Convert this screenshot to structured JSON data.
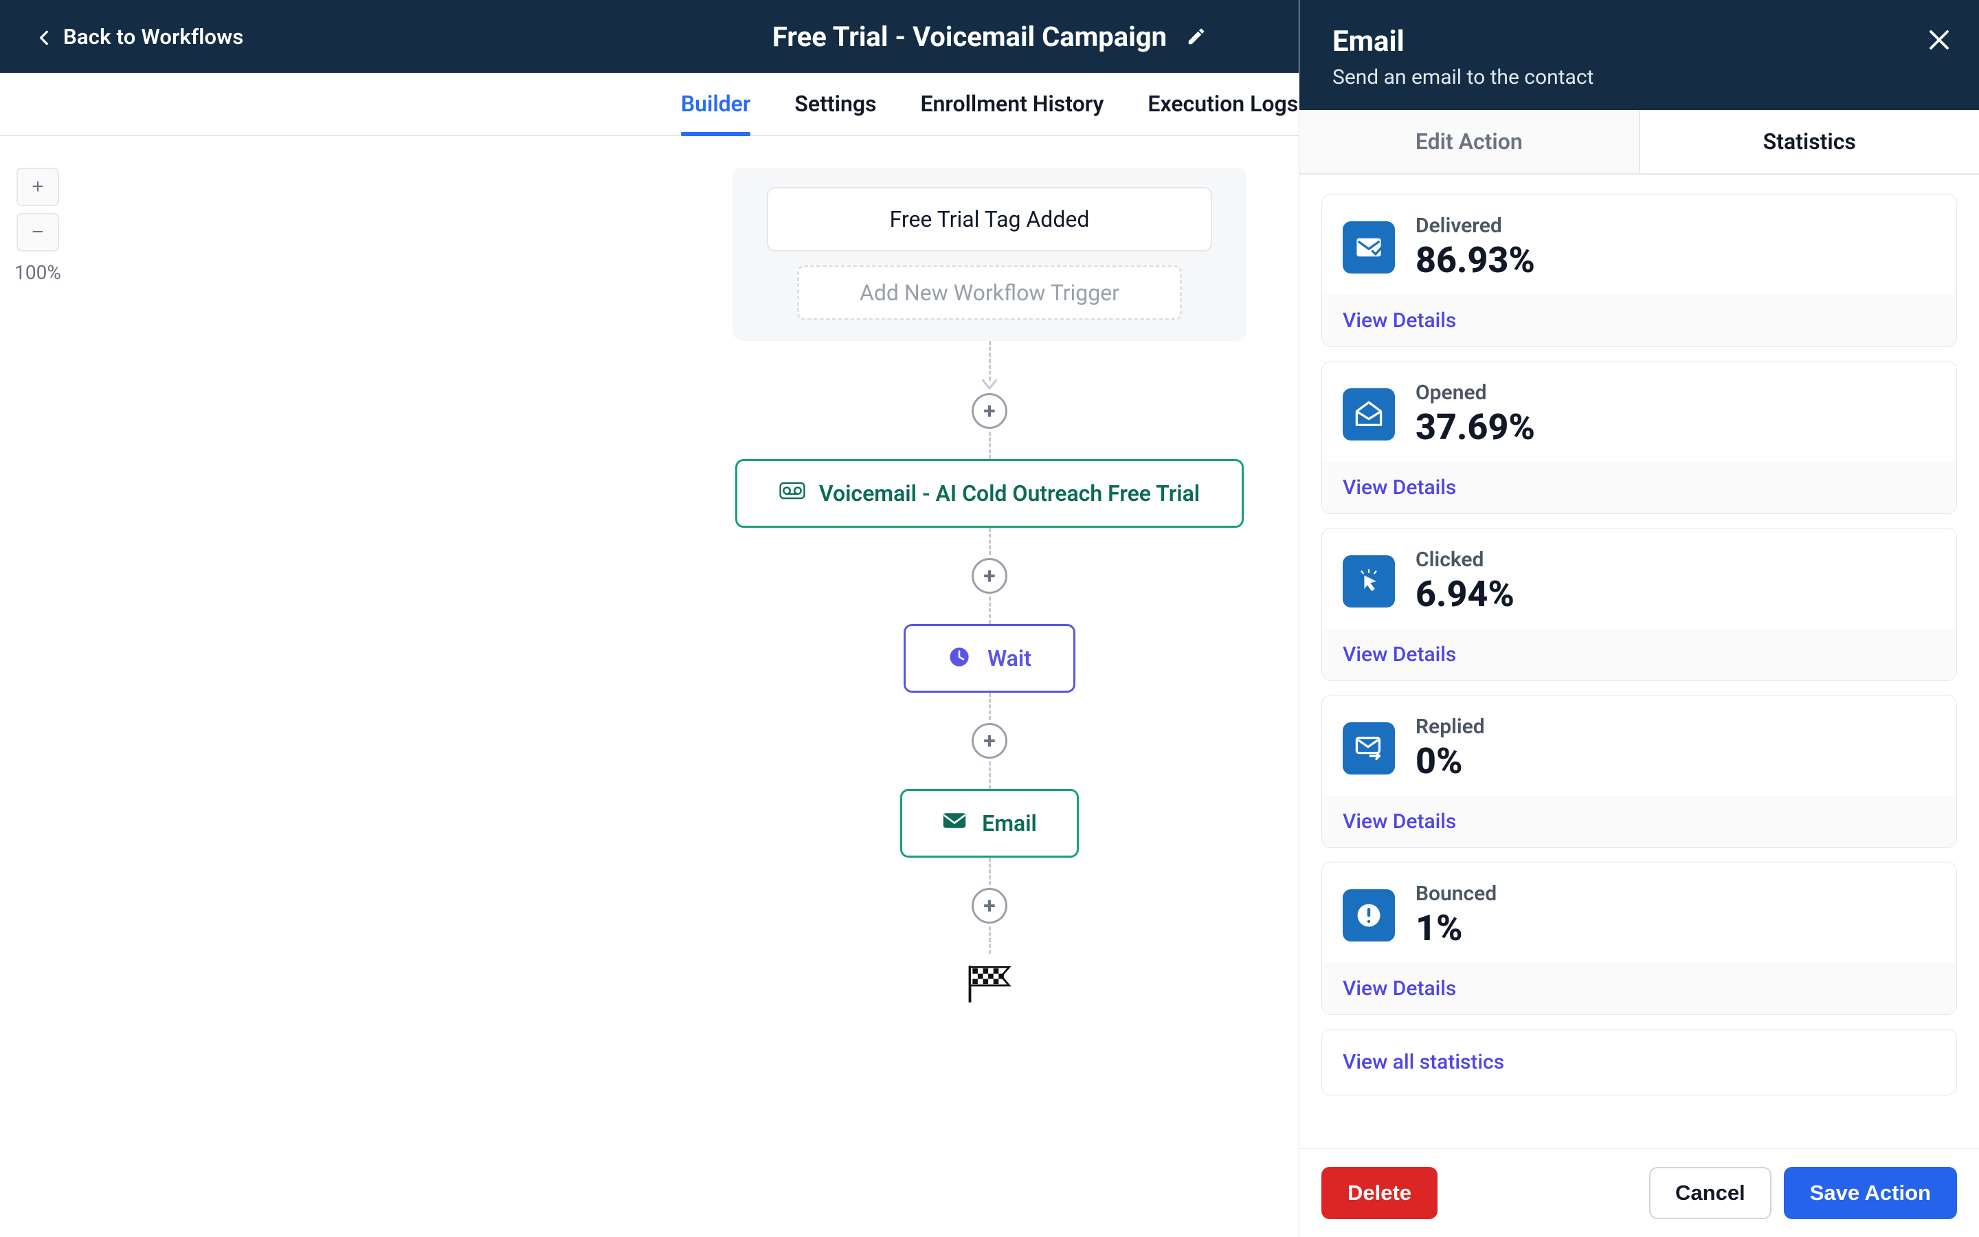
{
  "header": {
    "back_label": "Back to Workflows",
    "title": "Free Trial - Voicemail Campaign"
  },
  "tabs": {
    "builder": "Builder",
    "settings": "Settings",
    "enrollment": "Enrollment History",
    "execution": "Execution Logs"
  },
  "zoom": {
    "percent": "100%",
    "plus": "+",
    "minus": "−"
  },
  "flow": {
    "trigger_chip": "Free Trial Tag Added",
    "trigger_add": "Add New Workflow Trigger",
    "voicemail_node": "Voicemail - AI Cold Outreach Free Trial",
    "wait_node": "Wait",
    "email_node": "Email"
  },
  "panel": {
    "title": "Email",
    "subtitle": "Send an email to the contact",
    "tab_edit": "Edit Action",
    "tab_stats": "Statistics",
    "view_details": "View Details",
    "view_all": "View all statistics",
    "stats": [
      {
        "key": "delivered",
        "label": "Delivered",
        "value": "86.93%"
      },
      {
        "key": "opened",
        "label": "Opened",
        "value": "37.69%"
      },
      {
        "key": "clicked",
        "label": "Clicked",
        "value": "6.94%"
      },
      {
        "key": "replied",
        "label": "Replied",
        "value": "0%"
      },
      {
        "key": "bounced",
        "label": "Bounced",
        "value": "1%"
      }
    ],
    "buttons": {
      "delete": "Delete",
      "cancel": "Cancel",
      "save": "Save Action"
    }
  }
}
